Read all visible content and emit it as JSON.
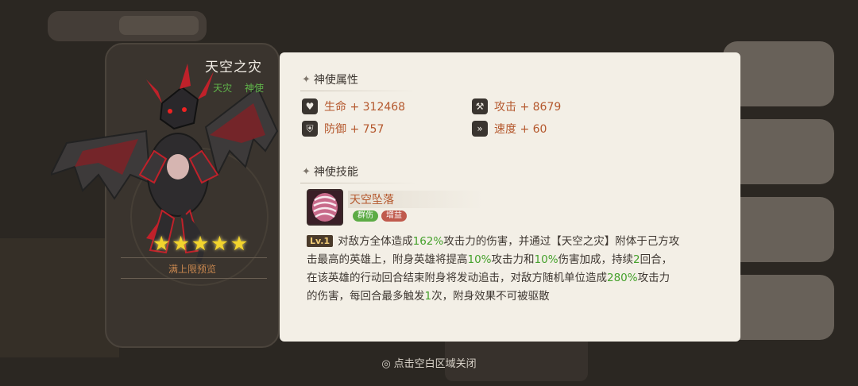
{
  "hero": {
    "name": "天空之灾",
    "tags": [
      "天灾",
      "神使"
    ],
    "stars": 5,
    "preview_label": "满上限预览"
  },
  "attributes": {
    "title": "神使属性",
    "stats": [
      {
        "icon": "heart-icon",
        "label": "生命 + 312468"
      },
      {
        "icon": "axe-icon",
        "label": "攻击 + 8679"
      },
      {
        "icon": "shield-icon",
        "label": "防御 + 757"
      },
      {
        "icon": "boot-icon",
        "label": "速度 + 60"
      }
    ]
  },
  "skill": {
    "title": "神使技能",
    "name": "天空坠落",
    "tags": [
      "群伤",
      "增益"
    ],
    "level": "Lv.1",
    "desc": [
      {
        "t": "对敌方全体造成"
      },
      {
        "t": "162%",
        "hl": true
      },
      {
        "t": "攻击力的伤害，并通过【天空之灾】附体于己方攻击最高的英雄上，附身英雄将提高"
      },
      {
        "t": "10%",
        "hl": true
      },
      {
        "t": "攻击力和"
      },
      {
        "t": "10%",
        "hl": true
      },
      {
        "t": "伤害加成，持续"
      },
      {
        "t": "2",
        "hl": true
      },
      {
        "t": "回合，在该英雄的行动回合结束附身将发动追击，对敌方随机单位造成"
      },
      {
        "t": "280%",
        "hl": true
      },
      {
        "t": "攻击力的伤害，每回合最多触发"
      },
      {
        "t": "1",
        "hl": true
      },
      {
        "t": "次，附身效果不可被驱散"
      }
    ]
  },
  "footer": {
    "close_hint": "点击空白区域关闭"
  },
  "colors": {
    "accent_orange": "#b4572c",
    "highlight_green": "#45a12c",
    "star_yellow": "#f2d42e"
  }
}
